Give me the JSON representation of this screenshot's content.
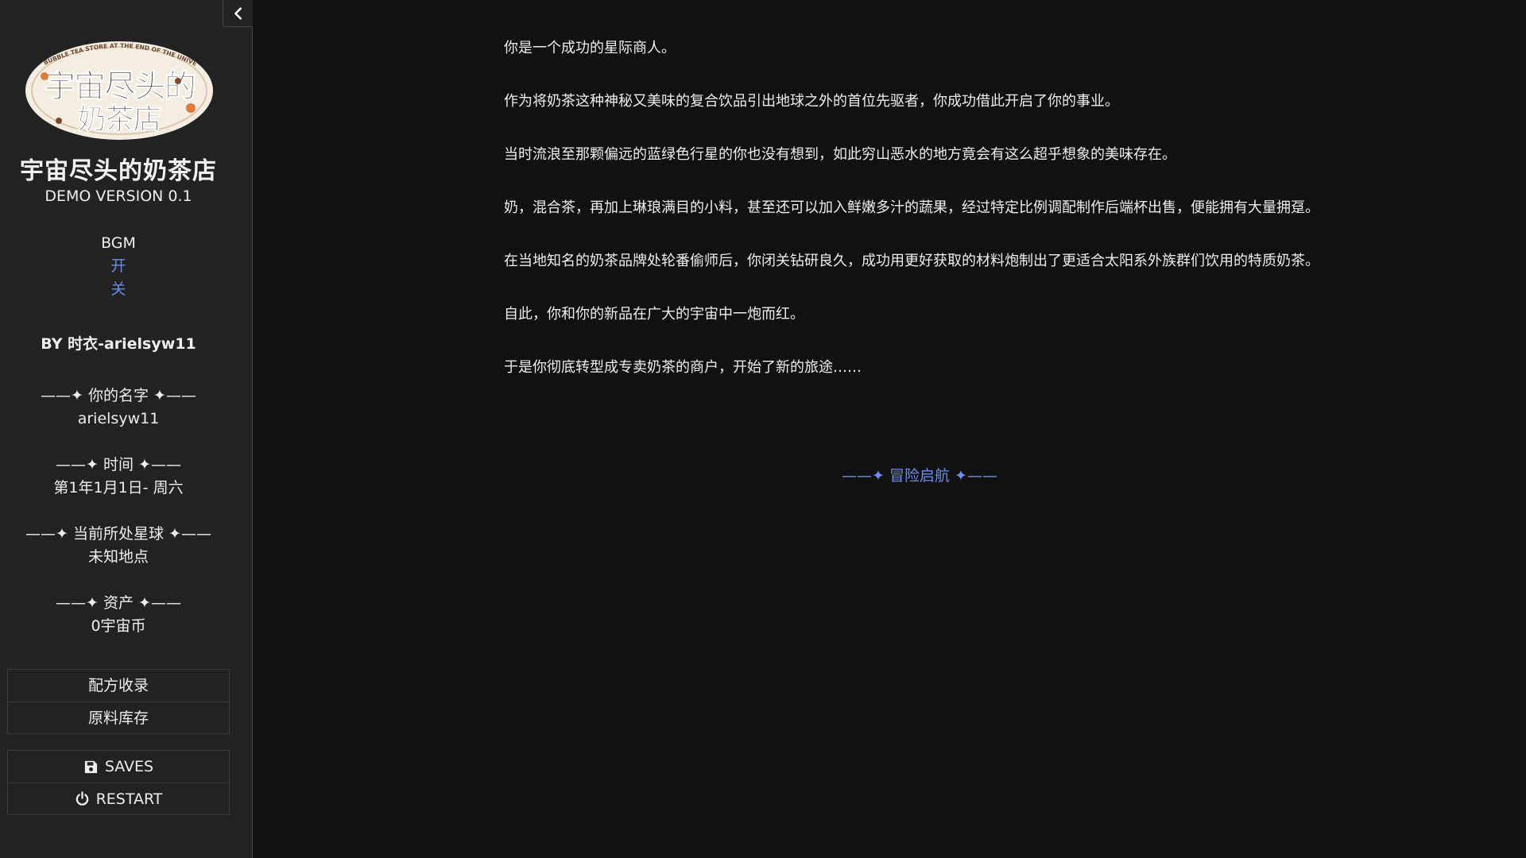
{
  "sidebar": {
    "logo_text": "宇宙尽头的奶茶店",
    "logo_arc_text": "THE BUBBLE TEA STORE AT THE END OF THE UNIVERSE",
    "title": "宇宙尽头的奶茶店",
    "subtitle": "DEMO VERSION 0.1",
    "bgm": {
      "label": "BGM",
      "on": "开",
      "off": "关"
    },
    "author": "BY 时衣-arielsyw11",
    "stats": {
      "name": {
        "label": "——✦ 你的名字 ✦——",
        "value": "arielsyw11"
      },
      "time": {
        "label": "——✦ 时间 ✦——",
        "value": "第1年1月1日- 周六"
      },
      "planet": {
        "label": "——✦ 当前所处星球 ✦——",
        "value": "未知地点"
      },
      "assets": {
        "label": "——✦ 资产 ✦——",
        "value": "0宇宙币"
      }
    },
    "menu": {
      "recipes": "配方收录",
      "inventory": "原料库存"
    },
    "system": {
      "saves": "SAVES",
      "restart": "RESTART"
    }
  },
  "passage": {
    "paragraphs": [
      "你是一个成功的星际商人。",
      "作为将奶茶这种神秘又美味的复合饮品引出地球之外的首位先驱者，你成功借此开启了你的事业。",
      "当时流浪至那颗偏远的蓝绿色行星的你也没有想到，如此穷山恶水的地方竟会有这么超乎想象的美味存在。",
      "奶，混合茶，再加上琳琅满目的小料，甚至还可以加入鲜嫩多汁的蔬果，经过特定比例调配制作后端杯出售，便能拥有大量拥趸。",
      "在当地知名的奶茶品牌处轮番偷师后，你闭关钻研良久，成功用更好获取的材料炮制出了更适合太阳系外族群们饮用的特质奶茶。",
      "自此，你和你的新品在广大的宇宙中一炮而红。",
      "于是你彻底转型成专卖奶茶的商户，开始了新的旅途……"
    ],
    "start_link": "——✦ 冒险启航 ✦——"
  },
  "colors": {
    "background": "#111111",
    "sidebar": "#222222",
    "link": "#6b8ce8",
    "text": "#eeeeee"
  }
}
